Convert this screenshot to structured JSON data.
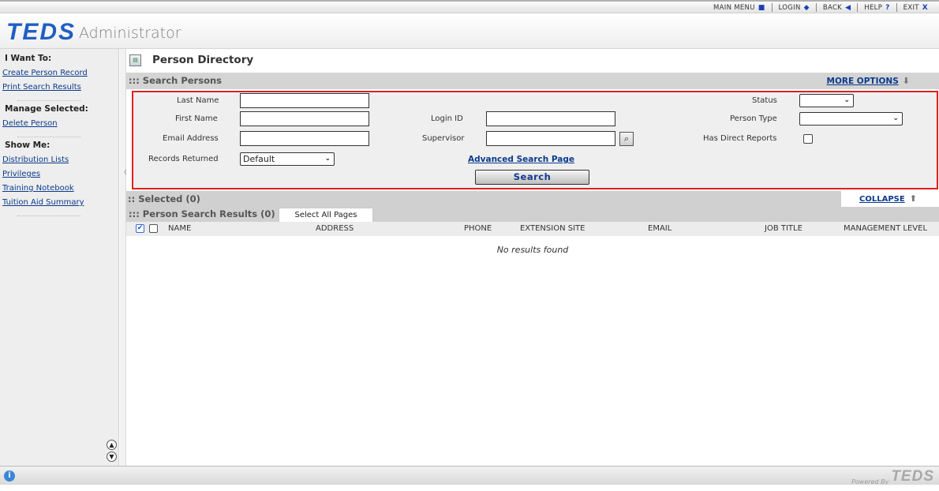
{
  "topnav": {
    "main_menu": "MAIN MENU",
    "login": "LOGIN",
    "back": "BACK",
    "help": "HELP",
    "exit": "EXIT",
    "icons": [
      "square-icon",
      "diamond-icon",
      "back-arrow-icon",
      "help-icon",
      "close-icon"
    ]
  },
  "header": {
    "logo": "TEDS",
    "app_name": "Administrator"
  },
  "sidebar": {
    "i_want_to": "I Want To:",
    "i_want_to_items": [
      "Create Person Record",
      "Print Search Results"
    ],
    "manage_selected": "Manage Selected:",
    "manage_selected_items": [
      "Delete Person"
    ],
    "show_me": "Show Me:",
    "show_me_items": [
      "Distribution Lists",
      "Privileges",
      "Training Notebook",
      "Tuition Aid Summary"
    ]
  },
  "page": {
    "title": "Person Directory"
  },
  "search": {
    "section_title": "::: Search Persons",
    "more_options": "MORE OPTIONS",
    "last_name_label": "Last Name",
    "first_name_label": "First Name",
    "email_label": "Email Address",
    "records_returned_label": "Records Returned",
    "records_returned_value": "Default",
    "login_id_label": "Login ID",
    "supervisor_label": "Supervisor",
    "status_label": "Status",
    "person_type_label": "Person Type",
    "has_direct_reports_label": "Has Direct Reports",
    "advanced_link": "Advanced Search Page",
    "search_button": "Search",
    "last_name_value": "",
    "first_name_value": "",
    "email_value": "",
    "login_id_value": "",
    "supervisor_value": "",
    "status_value": "",
    "person_type_value": ""
  },
  "selected": {
    "title": ":: Selected (0)",
    "collapse": "COLLAPSE"
  },
  "results": {
    "title": "::: Person Search Results (0)",
    "select_all_pages": "Select All Pages",
    "columns": [
      "NAME",
      "ADDRESS",
      "PHONE",
      "EXTENSION SITE",
      "EMAIL",
      "JOB TITLE",
      "MANAGEMENT LEVEL"
    ],
    "empty_message": "No results found"
  },
  "footer": {
    "powered": "Powered By",
    "logo": "TEDS"
  }
}
